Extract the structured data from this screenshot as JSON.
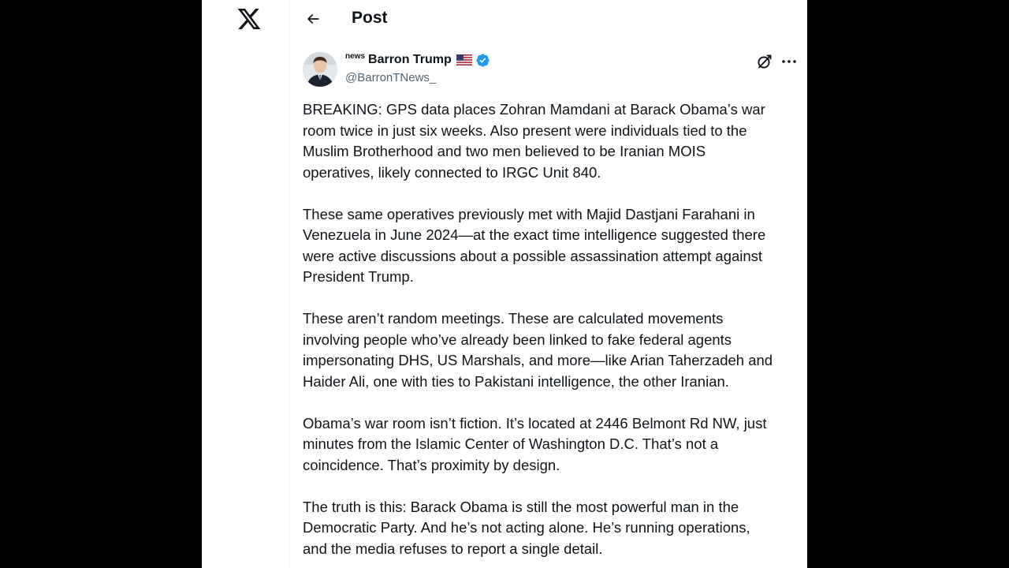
{
  "nav": {
    "logo_icon": "x-logo-icon",
    "back_icon": "arrow-left-icon",
    "title": "Post"
  },
  "post": {
    "author": {
      "badge_text": "news",
      "display_name": "Barron Trump",
      "flag_icon": "us-flag-icon",
      "verified_icon": "verified-badge-icon",
      "handle": "@BarronTNews_"
    },
    "actions": {
      "grok_icon": "grok-icon",
      "more_icon": "more-dots-icon"
    },
    "paragraphs": [
      "BREAKING: GPS data places Zohran Mamdani at Barack Obama’s war\nroom twice in just six weeks. Also present were individuals tied to the\nMuslim Brotherhood and two men believed to be Iranian MOIS\noperatives, likely connected to IRGC Unit 840.",
      "These same operatives previously met with Majid Dastjani Farahani in\nVenezuela in June 2024—at the exact time intelligence suggested there\nwere active discussions about a possible assassination attempt against\nPresident Trump.",
      "These aren’t random meetings. These are calculated movements\ninvolving people who’ve already been linked to fake federal agents\nimpersonating DHS, US Marshals, and more—like Arian Taherzadeh and\nHaider Ali, one with ties to Pakistani intelligence, the other Iranian.",
      "Obama’s war room isn’t fiction. It’s located at 2446 Belmont Rd NW, just\nminutes from the Islamic Center of Washington D.C. That’s not a\ncoincidence. That’s proximity by design.",
      "The truth is this: Barack Obama is still the most powerful man in the\nDemocratic Party. And he’s not acting alone. He’s running operations,\nand the media refuses to report a single detail."
    ]
  },
  "colors": {
    "background": "#000000",
    "panel": "#ffffff",
    "text": "#0f1419",
    "secondary_text": "#536471",
    "verified": "#1d9bf0",
    "border": "#eff3f4"
  }
}
